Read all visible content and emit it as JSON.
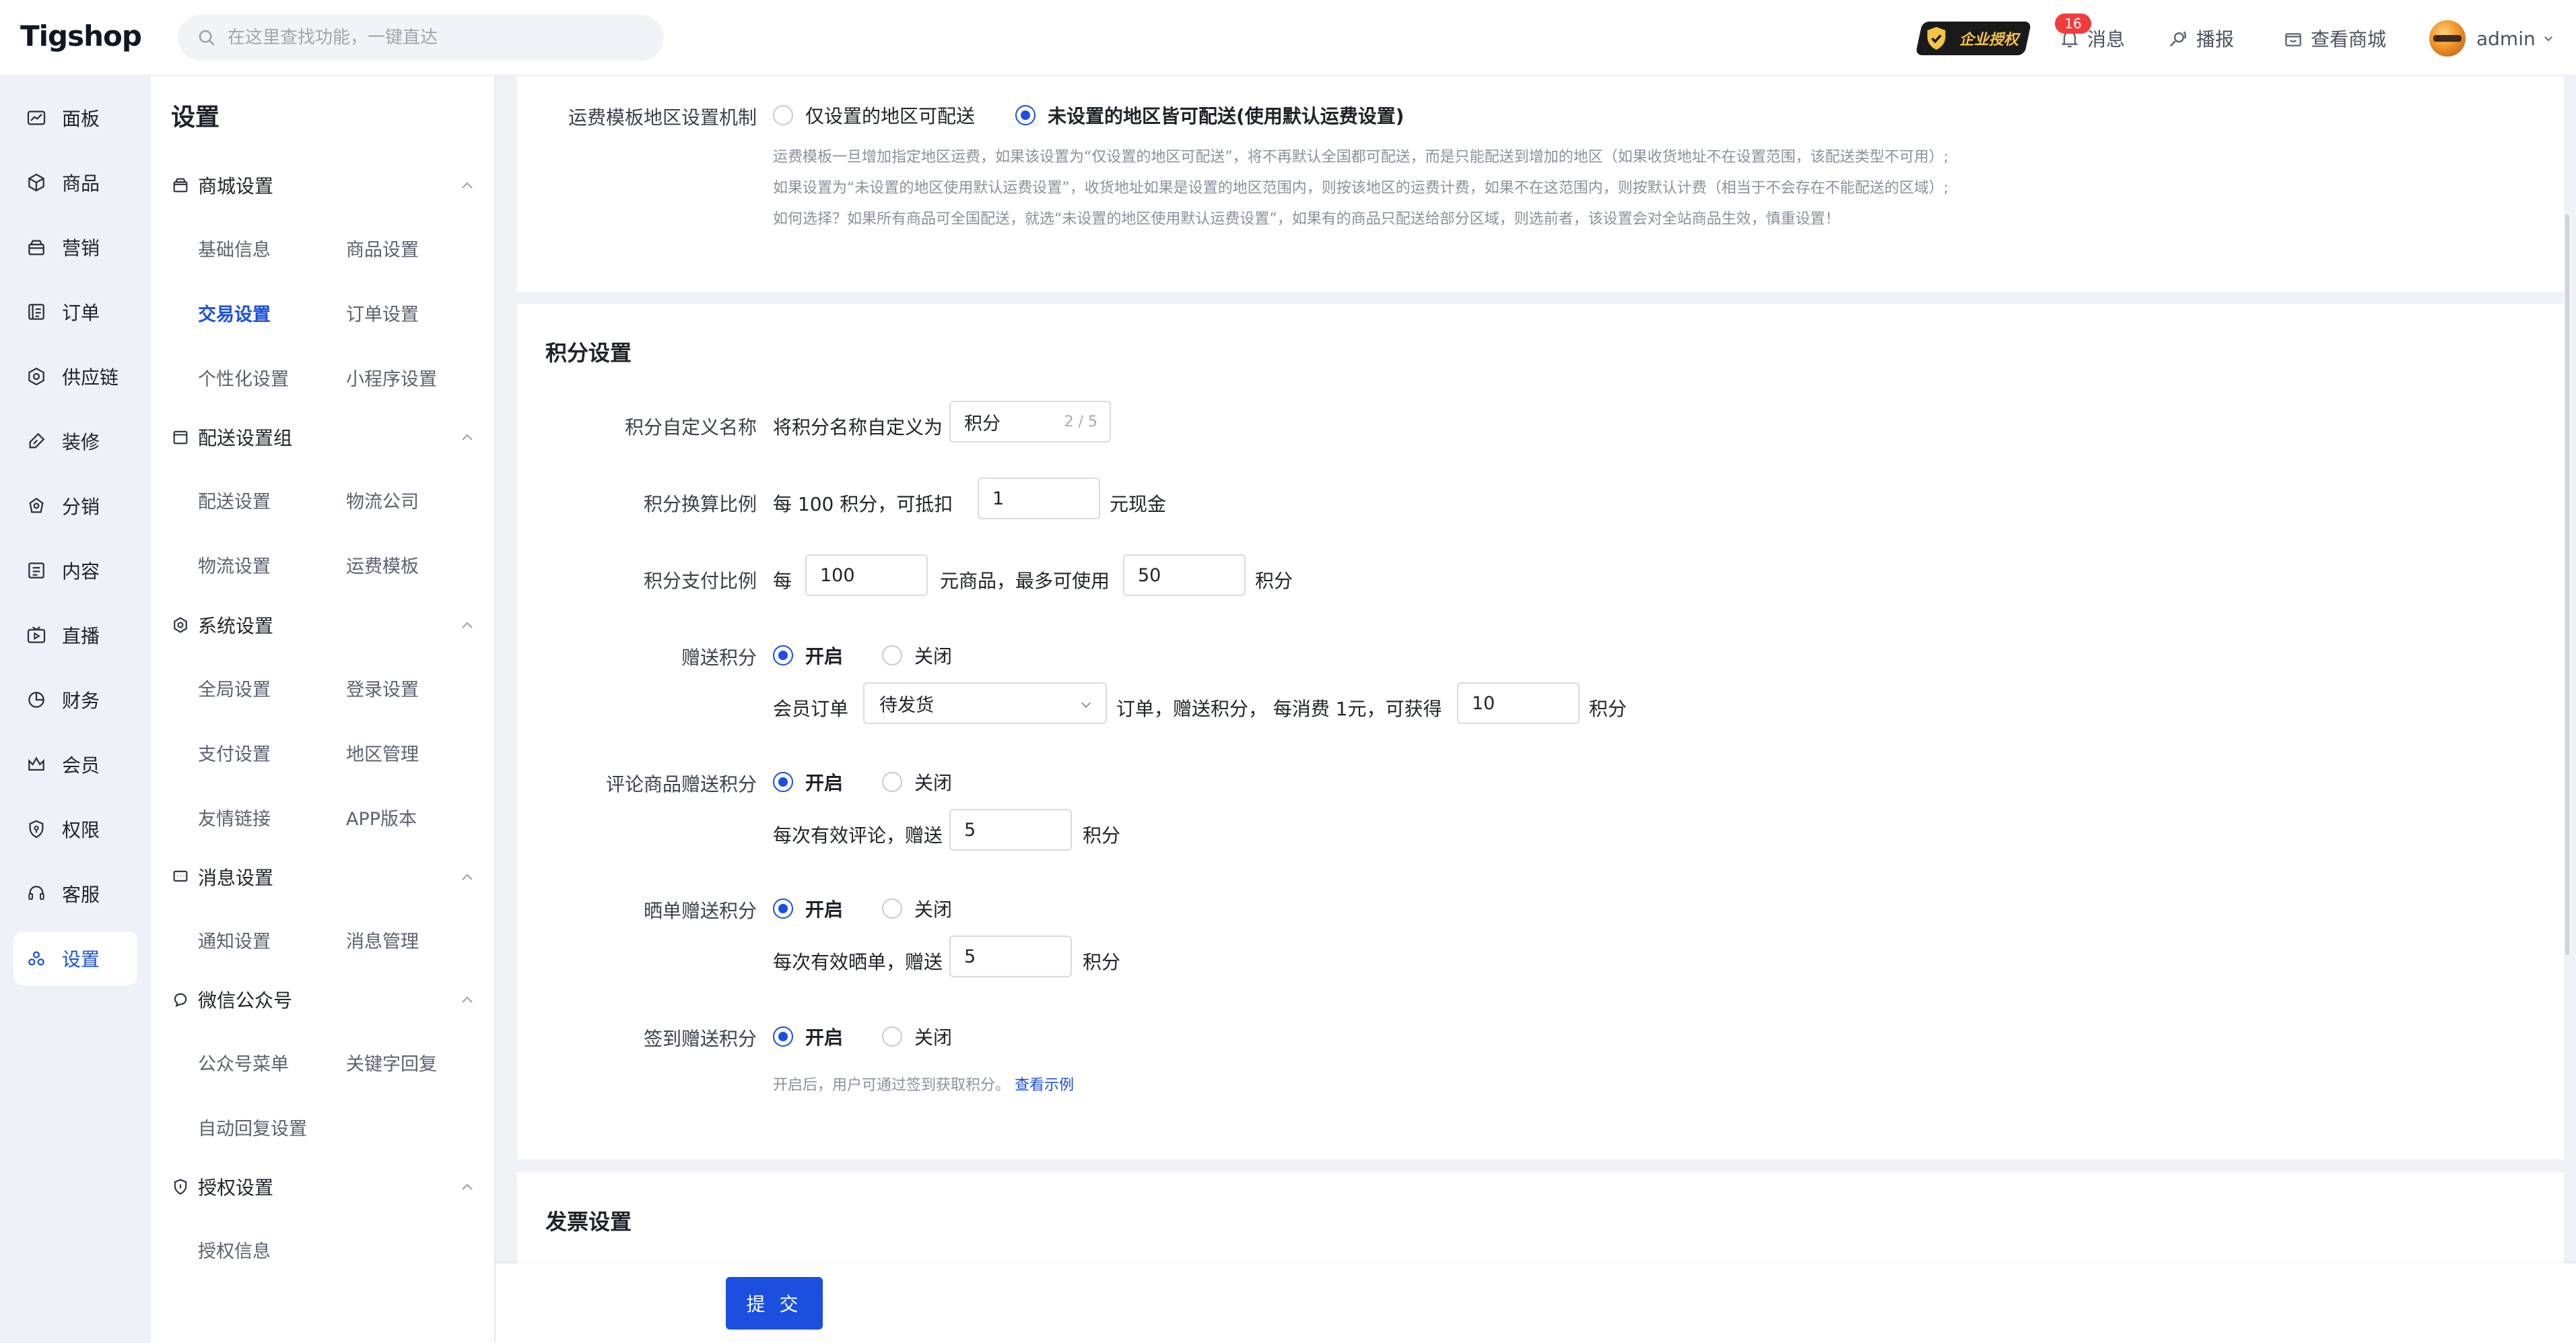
{
  "app": {
    "logo": "Tigshop"
  },
  "search": {
    "placeholder": "在这里查找功能，一键直达"
  },
  "topbar": {
    "auth_badge": "企业授权",
    "message_count": "16",
    "message_label": "消息",
    "broadcast_label": "播报",
    "view_store_label": "查看商城",
    "user_name": "admin"
  },
  "leftnav": {
    "items": [
      {
        "label": "面板",
        "icon": "dashboard-icon"
      },
      {
        "label": "商品",
        "icon": "box-icon"
      },
      {
        "label": "营销",
        "icon": "marketing-icon"
      },
      {
        "label": "订单",
        "icon": "order-icon"
      },
      {
        "label": "供应链",
        "icon": "supply-icon"
      },
      {
        "label": "装修",
        "icon": "brush-icon"
      },
      {
        "label": "分销",
        "icon": "distribution-icon"
      },
      {
        "label": "内容",
        "icon": "content-icon"
      },
      {
        "label": "直播",
        "icon": "live-icon"
      },
      {
        "label": "财务",
        "icon": "finance-icon"
      },
      {
        "label": "会员",
        "icon": "crown-icon"
      },
      {
        "label": "权限",
        "icon": "shield-icon"
      },
      {
        "label": "客服",
        "icon": "service-icon"
      },
      {
        "label": "设置",
        "icon": "settings-icon",
        "active": true
      }
    ]
  },
  "submenu": {
    "title": "设置",
    "groups": [
      {
        "label": "商城设置",
        "links": [
          "基础信息",
          "商品设置",
          "交易设置",
          "订单设置",
          "个性化设置",
          "小程序设置"
        ]
      },
      {
        "label": "配送设置组",
        "links": [
          "配送设置",
          "物流公司",
          "物流设置",
          "运费模板"
        ]
      },
      {
        "label": "系统设置",
        "links": [
          "全局设置",
          "登录设置",
          "支付设置",
          "地区管理",
          "友情链接",
          "APP版本"
        ]
      },
      {
        "label": "消息设置",
        "links": [
          "通知设置",
          "消息管理"
        ]
      },
      {
        "label": "微信公众号",
        "links": [
          "公众号菜单",
          "关键字回复",
          "自动回复设置"
        ]
      },
      {
        "label": "授权设置",
        "links": [
          "授权信息"
        ]
      }
    ],
    "active_link": "交易设置"
  },
  "freight": {
    "label": "运费模板地区设置机制",
    "option_a": "仅设置的地区可配送",
    "option_b": "未设置的地区皆可配送(使用默认运费设置)",
    "hint_1": "运费模板一旦增加指定地区运费，如果该设置为“仅设置的地区可配送”，将不再默认全国都可配送，而是只能配送到增加的地区（如果收货地址不在设置范围，该配送类型不可用）;",
    "hint_2": "如果设置为“未设置的地区使用默认运费设置”，收货地址如果是设置的地区范围内，则按该地区的运费计费，如果不在这范围内，则按默认计费（相当于不会存在不能配送的区域）;",
    "hint_3": "如何选择？如果所有商品可全国配送，就选“未设置的地区使用默认运费设置”，如果有的商品只配送给部分区域，则选前者，该设置会对全站商品生效，慎重设置！"
  },
  "points": {
    "section_title": "积分设置",
    "custom_name_label": "积分自定义名称",
    "custom_name_prefix": "将积分名称自定义为",
    "custom_name_value": "积分",
    "custom_name_count": "2 / 5",
    "ratio_label": "积分换算比例",
    "ratio_prefix": "每 100 积分，可抵扣",
    "ratio_value": "1",
    "ratio_suffix": "元现金",
    "pay_label": "积分支付比例",
    "pay_prefix": "每",
    "pay_value_1": "100",
    "pay_middle": "元商品，最多可使用",
    "pay_value_2": "50",
    "pay_suffix": "积分",
    "gift_label": "赠送积分",
    "on": "开启",
    "off": "关闭",
    "gift_order_prefix": "会员订单",
    "gift_order_status": "待发货",
    "gift_order_middle": "订单，赠送积分，  每消费 1元，可获得",
    "gift_order_value": "10",
    "gift_order_suffix": "积分",
    "review_label": "评论商品赠送积分",
    "review_prefix": "每次有效评论，赠送",
    "review_value": "5",
    "review_suffix": "积分",
    "share_label": "晒单赠送积分",
    "share_prefix": "每次有效晒单，赠送",
    "share_value": "5",
    "share_suffix": "积分",
    "signin_label": "签到赠送积分",
    "signin_hint": "开启后，用户可通过签到获取积分。",
    "signin_link": "查看示例"
  },
  "invoice": {
    "section_title": "发票设置"
  },
  "footer": {
    "submit_label": "提 交"
  },
  "colors": {
    "primary": "#1a4fe0",
    "badge_red": "#f23c3c"
  }
}
